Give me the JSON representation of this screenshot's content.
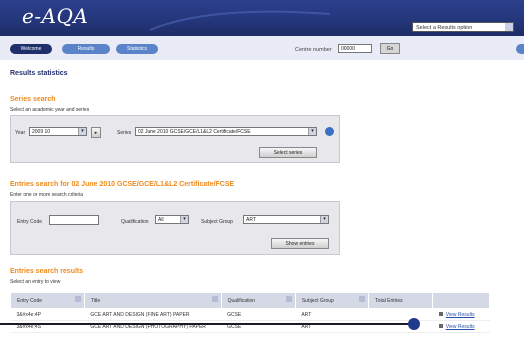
{
  "header": {
    "logo": "e-AQA",
    "quick_select": "Select a Results option"
  },
  "nav": {
    "pills": [
      "Welcome",
      "Results",
      "Statistics"
    ],
    "centre_label": "Centre number",
    "centre_value": "00000",
    "go_label": "Go"
  },
  "page": {
    "title": "Results statistics"
  },
  "series": {
    "heading": "Series search",
    "instruction": "Select an academic year and series",
    "year_label": "Year",
    "year_value": "2009 10",
    "series_label": "Series",
    "series_value": "02 June 2010 GCSE/GCE/L1&L2 Certificate/FCSE",
    "select_button": "Select series"
  },
  "entries": {
    "heading": "Entries search for 02 June 2010 GCSE/GCE/L1&L2 Certificate/FCSE",
    "instruction": "Enter one or more search criteria",
    "entry_code_label": "Entry Code",
    "entry_code_value": "",
    "qualification_label": "Qualification",
    "qualification_value": "All",
    "subject_label": "Subject Group",
    "subject_value": "ART",
    "show_button": "Show entries"
  },
  "results": {
    "heading": "Entries search results",
    "instruction": "Select an entry to view",
    "columns": [
      "Entry Code",
      "Title",
      "Qualification",
      "Subject Group",
      "Total Entries",
      ""
    ],
    "rows": [
      {
        "code": "3&#x4e;4P",
        "title": "GCE ART AND DESIGN (FINE ART) PAPER",
        "qual": "GCSE",
        "subject": "ART",
        "total": "",
        "link": "View Results"
      },
      {
        "code": "3&#x4e;4S",
        "title": "GCE ART AND DESIGN (PHOTOGRAPHY) PAPER",
        "qual": "GCSE",
        "subject": "ART",
        "total": "",
        "link": "View Results"
      }
    ]
  },
  "colors": {
    "banner": "#24367a",
    "accent_orange": "#f08a1c",
    "nav_pill_dark": "#1e2f6b",
    "nav_pill_light": "#5a83c9"
  }
}
